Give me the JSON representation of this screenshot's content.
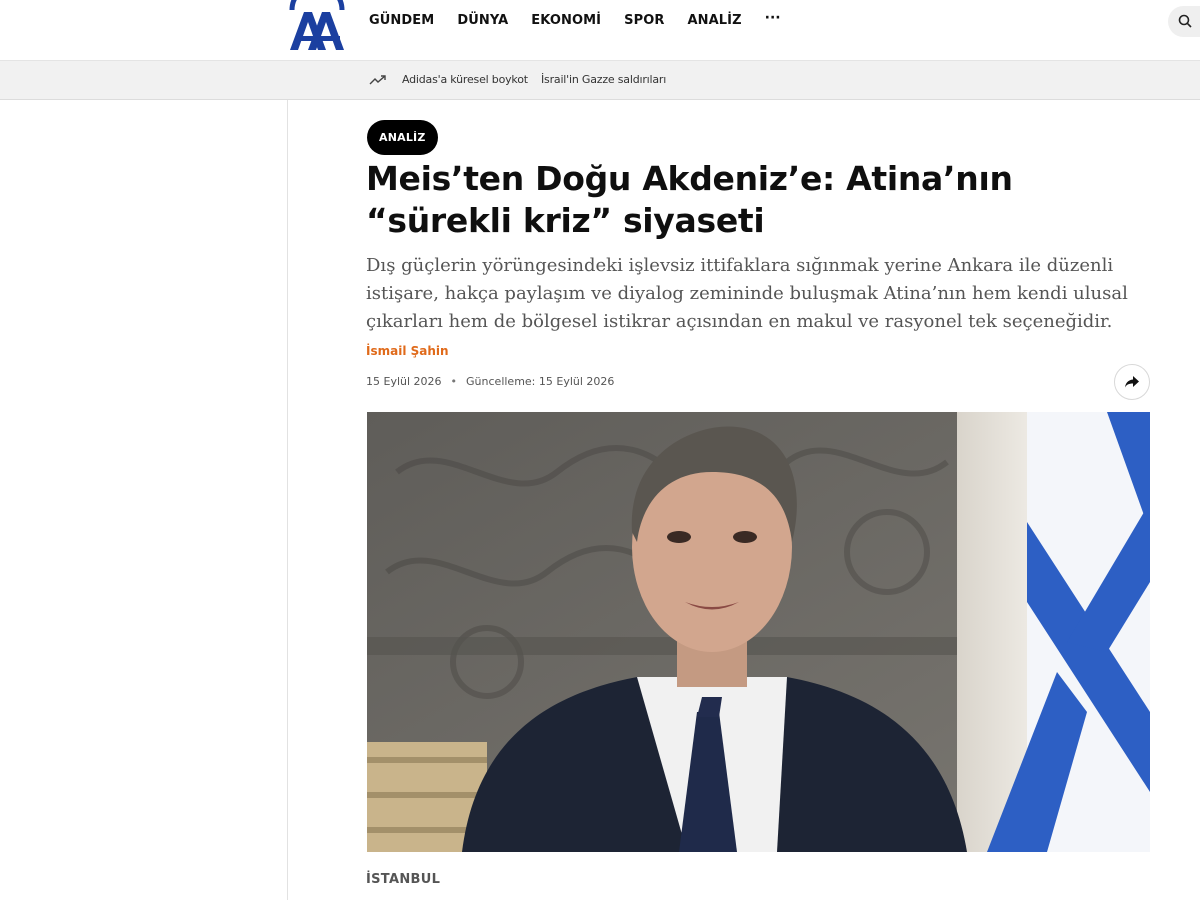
{
  "header": {
    "logo_text": "AA",
    "nav": [
      {
        "label": "GÜNDEM"
      },
      {
        "label": "DÜNYA"
      },
      {
        "label": "EKONOMİ"
      },
      {
        "label": "SPOR"
      },
      {
        "label": "ANALİZ"
      }
    ],
    "more_label": "···",
    "search_icon": "search-icon"
  },
  "trending": {
    "icon": "trending-up-icon",
    "links": [
      {
        "label": "Adidas'a küresel boykot"
      },
      {
        "label": "İsrail'in Gazze saldırıları"
      }
    ]
  },
  "article": {
    "category": "ANALİZ",
    "title": "Meis’ten Doğu Akdeniz’e: Atina’nın “sürekli kriz” siyaseti",
    "summary": "Dış güçlerin yörüngesindeki işlevsiz ittifaklara sığınmak yerine Ankara ile düzenli istişare, hakça paylaşım ve diyalog zemininde buluşmak Atina’nın hem kendi ulusal çıkarları hem de bölgesel istikrar açısından en makul ve rasyonel tek seçeneğidir.",
    "author": "İsmail Şahin",
    "published": "15 Eylül 2026",
    "updated": "Güncelleme: 15 Eylül 2026",
    "share_icon": "share-icon",
    "dateline": "İSTANBUL"
  },
  "colors": {
    "brand_blue": "#1b3fa0",
    "author_orange": "#e06a1a",
    "badge_black": "#000000",
    "flag_blue": "#2d5fc4"
  }
}
